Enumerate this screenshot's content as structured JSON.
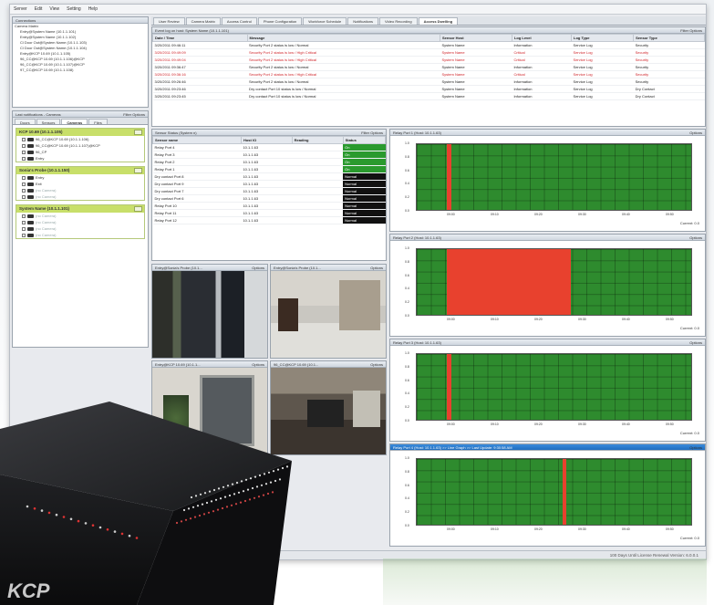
{
  "menu": [
    "Server",
    "Edit",
    "View",
    "Setting",
    "Help"
  ],
  "tabs": [
    {
      "label": "User Review"
    },
    {
      "label": "Camera Matrix"
    },
    {
      "label": "Access Control"
    },
    {
      "label": "Phone Configuration"
    },
    {
      "label": "Workforce Schedule"
    },
    {
      "label": "Notifications"
    },
    {
      "label": "Video Recording"
    },
    {
      "label": "Access Dwelling",
      "active": true
    }
  ],
  "sidebar": {
    "tree_title": "Connections",
    "tree": [
      "Camera Matrix",
      "Entry@System Name (10.1.1.101)",
      "Entry@System Name (10.1.1.102)",
      "Cl Door Out@System Name (10.1.1.103)",
      "Cl Door Out@System Name (10.1.1.104)",
      "Entry@KCP 10.69 (10.1.1.105)",
      "96_CC@KCP 10.69 (10.1.1.106)@KCP",
      "96_CC@KCP 10.69 (10.1.1.107)@KCP",
      "97_CC@KCP 10.69 (10.1.1.108)"
    ],
    "notif_title": "Last notifications - Cameras",
    "notif_filter": "Filter",
    "notif_options": "Options",
    "notif_tabs": [
      "Doors",
      "Sensors",
      "Cameras",
      "Files"
    ],
    "groups": [
      {
        "title": "KCP 10.69 (10.1.1.105)",
        "items": [
          {
            "label": "96_CC@KCP 10.69 (10.1.1.106)",
            "dis": false
          },
          {
            "label": "96_CC@KCP 10.69 (10.1.1.107)@KCP",
            "dis": false
          },
          {
            "label": "96_CP",
            "dis": false
          },
          {
            "label": "Entry",
            "dis": false
          }
        ]
      },
      {
        "title": "Sonia's Probe (10.1.1.150)",
        "items": [
          {
            "label": "Entry",
            "dis": false
          },
          {
            "label": "Exit",
            "dis": false
          },
          {
            "label": "(no Camera)",
            "dis": true
          },
          {
            "label": "(no Camera)",
            "dis": true
          }
        ]
      },
      {
        "title": "System Name (10.1.1.101)",
        "items": [
          {
            "label": "(no Camera)",
            "dis": true
          },
          {
            "label": "(no Camera)",
            "dis": true
          },
          {
            "label": "(no Camera)",
            "dis": true
          },
          {
            "label": "(no Camera)",
            "dis": true
          }
        ]
      }
    ]
  },
  "events": {
    "title": "Event log on host: System Name (10.1.1.101)",
    "filter": "Filter",
    "options": "Options",
    "columns": [
      "Date / Time",
      "Message",
      "Sensor Host",
      "Log Level",
      "Log Type",
      "Sensor Type"
    ],
    "rows": [
      {
        "dt": "3/20/2011 09:46:11",
        "msg": "Security Port 2 status is low / Normal",
        "host": "System Name",
        "lvl": "Information",
        "type": "Service Log",
        "stype": "Security",
        "red": false
      },
      {
        "dt": "3/20/2011 09:49:09",
        "msg": "Security Port 2 status is low / High Critical",
        "host": "System Name",
        "lvl": "Critical",
        "type": "Service Log",
        "stype": "Security",
        "red": true
      },
      {
        "dt": "3/20/2011 09:49:04",
        "msg": "Security Port 2 status is low / High Critical",
        "host": "System Name",
        "lvl": "Critical",
        "type": "Service Log",
        "stype": "Security",
        "red": true
      },
      {
        "dt": "3/20/2011 09:36:47",
        "msg": "Security Port 2 status is low / Normal",
        "host": "System Name",
        "lvl": "Information",
        "type": "Service Log",
        "stype": "Security",
        "red": false
      },
      {
        "dt": "3/20/2011 09:36:16",
        "msg": "Security Port 2 status is low / High Critical",
        "host": "System Name",
        "lvl": "Critical",
        "type": "Service Log",
        "stype": "Security",
        "red": true
      },
      {
        "dt": "3/20/2011 09:26:46",
        "msg": "Security Port 2 status is low / Normal",
        "host": "System Name",
        "lvl": "Information",
        "type": "Service Log",
        "stype": "Security",
        "red": false
      },
      {
        "dt": "3/20/2011 09:23:46",
        "msg": "Dry contact Port 10 status is low / Normal",
        "host": "System Name",
        "lvl": "Information",
        "type": "Service Log",
        "stype": "Dry Contact",
        "red": false
      },
      {
        "dt": "3/20/2011 09:23:45",
        "msg": "Dry contact Port 10 status is low / Normal",
        "host": "System Name",
        "lvl": "Information",
        "type": "Service Log",
        "stype": "Dry Contact",
        "red": false
      }
    ]
  },
  "sensors": {
    "title": "Sensor Status (System n)",
    "filter": "Filter",
    "options": "Options",
    "columns": [
      "Sensor name",
      "Host IO",
      "Reading",
      "Status"
    ],
    "rows": [
      {
        "name": "Relay Port 4",
        "host": "10.1.1.63",
        "status": "On",
        "ok": true
      },
      {
        "name": "Relay Port 3",
        "host": "10.1.1.63",
        "status": "On",
        "ok": true
      },
      {
        "name": "Relay Port 2",
        "host": "10.1.1.63",
        "status": "On",
        "ok": true
      },
      {
        "name": "Relay Port 1",
        "host": "10.1.1.63",
        "status": "On",
        "ok": true
      },
      {
        "name": "Dry contact Port 8",
        "host": "10.1.1.63",
        "status": "Normal",
        "ok": false
      },
      {
        "name": "Dry contact Port 9",
        "host": "10.1.1.63",
        "status": "Normal",
        "ok": false
      },
      {
        "name": "Dry contact Port 7",
        "host": "10.1.1.63",
        "status": "Normal",
        "ok": false
      },
      {
        "name": "Dry contact Port 6",
        "host": "10.1.1.63",
        "status": "Normal",
        "ok": false
      },
      {
        "name": "Relay Port 10",
        "host": "10.1.1.63",
        "status": "Normal",
        "ok": false
      },
      {
        "name": "Relay Port 11",
        "host": "10.1.1.63",
        "status": "Normal",
        "ok": false
      },
      {
        "name": "Relay Port 12",
        "host": "10.1.1.63",
        "status": "Normal",
        "ok": false
      }
    ]
  },
  "cameras": [
    {
      "title": "Entry@Sonia's Probe (10.1...",
      "options": "Options"
    },
    {
      "title": "Entry@Sonia's Probe (10.1...",
      "options": "Options"
    },
    {
      "title": "Entry@KCP 10.69 (10.1.1...",
      "options": "Options"
    },
    {
      "title": "96_CC@KCP 10.69 (10.1...",
      "options": "Options"
    }
  ],
  "graphs": [
    {
      "title": "Relay Port 1 (Host: 10.1.1.63)",
      "options": "Options",
      "current": "Current: 0.0",
      "selected": false
    },
    {
      "title": "Relay Port 2 (Host: 10.1.1.63)",
      "options": "Options",
      "current": "Current: 0.0",
      "selected": false
    },
    {
      "title": "Relay Port 3 (Host: 10.1.1.63)",
      "options": "Options",
      "current": "Current: 0.0",
      "selected": false
    },
    {
      "title": "Relay Port 4 (Host: 10.1.1.63) >> Line Graph >> Last Update: 9:30:58 AM",
      "options": "Options",
      "current": "Current: 0.0",
      "selected": true
    }
  ],
  "chart_data": [
    {
      "type": "area",
      "title": "Relay Port 1 (Host: 10.1.1.63)",
      "x": [
        "09:00",
        "09:10",
        "09:20",
        "09:30",
        "09:40",
        "09:50"
      ],
      "yticks": [
        "1.0",
        "0.8",
        "0.6",
        "0.4",
        "0.2",
        "0.0"
      ],
      "events": [
        [
          0.11,
          0.125
        ]
      ]
    },
    {
      "type": "area",
      "title": "Relay Port 2 (Host: 10.1.1.63)",
      "x": [
        "09:00",
        "09:10",
        "09:20",
        "09:30",
        "09:40",
        "09:50"
      ],
      "yticks": [
        "1.0",
        "0.8",
        "0.6",
        "0.4",
        "0.2",
        "0.0"
      ],
      "events": [
        [
          0.11,
          0.56
        ]
      ]
    },
    {
      "type": "area",
      "title": "Relay Port 3 (Host: 10.1.1.63)",
      "x": [
        "09:00",
        "09:10",
        "09:20",
        "09:30",
        "09:40",
        "09:50"
      ],
      "yticks": [
        "1.0",
        "0.8",
        "0.6",
        "0.4",
        "0.2",
        "0.0"
      ],
      "events": [
        [
          0.11,
          0.125
        ]
      ]
    },
    {
      "type": "area",
      "title": "Relay Port 4 (Host: 10.1.1.63)",
      "x": [
        "09:00",
        "09:10",
        "09:20",
        "09:30",
        "09:40",
        "09:50"
      ],
      "yticks": [
        "1.0",
        "0.8",
        "0.6",
        "0.4",
        "0.2",
        "0.0"
      ],
      "events": [
        [
          0.53,
          0.545
        ]
      ]
    }
  ],
  "status_bar": "100 Days Until License Renewal    Version: 6.0.0.1",
  "device": {
    "brand": "KCP"
  }
}
